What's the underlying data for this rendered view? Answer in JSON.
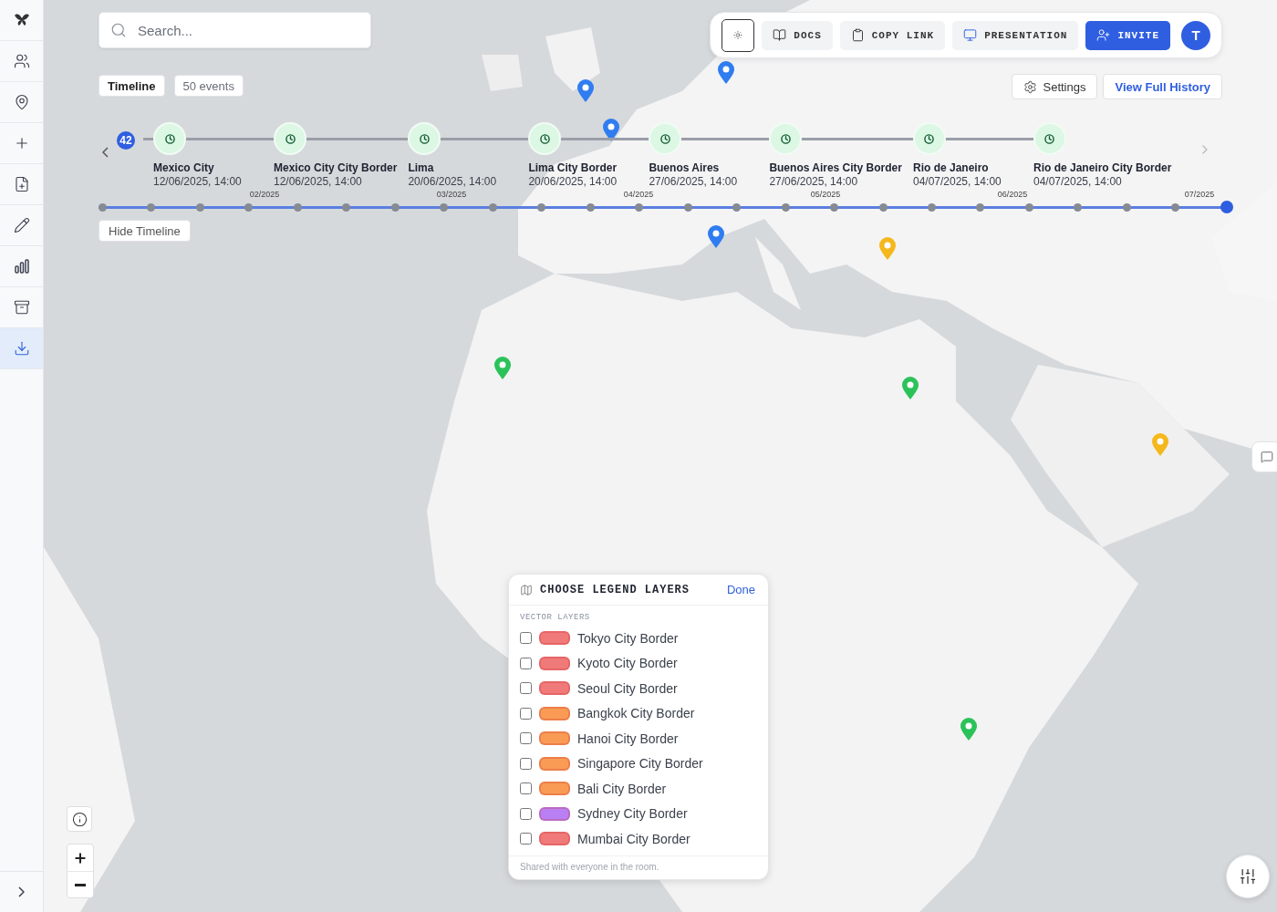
{
  "sidebar": {
    "items": [
      {
        "selected": false
      },
      {
        "selected": false
      },
      {
        "selected": false
      },
      {
        "selected": false
      },
      {
        "selected": false
      },
      {
        "selected": false
      },
      {
        "selected": false
      },
      {
        "selected": false
      },
      {
        "selected": true
      }
    ]
  },
  "search": {
    "placeholder": "Search..."
  },
  "timeline": {
    "title": "Timeline",
    "count": "50 events",
    "badge": "42",
    "hide_button": "Hide Timeline",
    "events": [
      {
        "name": "Mexico City",
        "date": "12/06/2025, 14:00"
      },
      {
        "name": "Mexico City City Border",
        "date": "12/06/2025, 14:00"
      },
      {
        "name": "Lima",
        "date": "20/06/2025, 14:00"
      },
      {
        "name": "Lima City Border",
        "date": "20/06/2025, 14:00"
      },
      {
        "name": "Buenos Aires",
        "date": "27/06/2025, 14:00"
      },
      {
        "name": "Buenos Aires City Border",
        "date": "27/06/2025, 14:00"
      },
      {
        "name": "Rio de Janeiro",
        "date": "04/07/2025, 14:00"
      },
      {
        "name": "Rio de Janeiro City Border",
        "date": "04/07/2025, 14:00"
      }
    ],
    "months": [
      "02/2025",
      "03/2025",
      "04/2025",
      "05/2025",
      "06/2025",
      "07/2025"
    ]
  },
  "toolbar": {
    "buttons": [
      {
        "kind": "theme"
      },
      {
        "kind": "docs",
        "label": "DOCS"
      },
      {
        "kind": "copy",
        "label": "COPY LINK"
      },
      {
        "kind": "presentation",
        "label": "PRESENTATION"
      },
      {
        "kind": "invite",
        "label": "INVITE"
      }
    ],
    "avatar": "T"
  },
  "history": {
    "settings": "Settings",
    "view": "View Full History"
  },
  "legend": {
    "title": "CHOOSE LEGEND LAYERS",
    "done": "Done",
    "section": "VECTOR LAYERS",
    "footer": "Shared with everyone in the room.",
    "layers": [
      {
        "name": "Tokyo City Border",
        "color": "#f07a7a",
        "checked": false
      },
      {
        "name": "Kyoto City Border",
        "color": "#f07a7a",
        "checked": false
      },
      {
        "name": "Seoul City Border",
        "color": "#f07a7a",
        "checked": false
      },
      {
        "name": "Bangkok City Border",
        "color": "#f99b55",
        "checked": false
      },
      {
        "name": "Hanoi City Border",
        "color": "#f99b55",
        "checked": false
      },
      {
        "name": "Singapore City Border",
        "color": "#f99b55",
        "checked": false
      },
      {
        "name": "Bali City Border",
        "color": "#f99b55",
        "checked": false
      },
      {
        "name": "Sydney City Border",
        "color": "#b880f2",
        "checked": false
      },
      {
        "name": "Mumbai City Border",
        "color": "#f07a7a",
        "checked": false
      }
    ]
  }
}
